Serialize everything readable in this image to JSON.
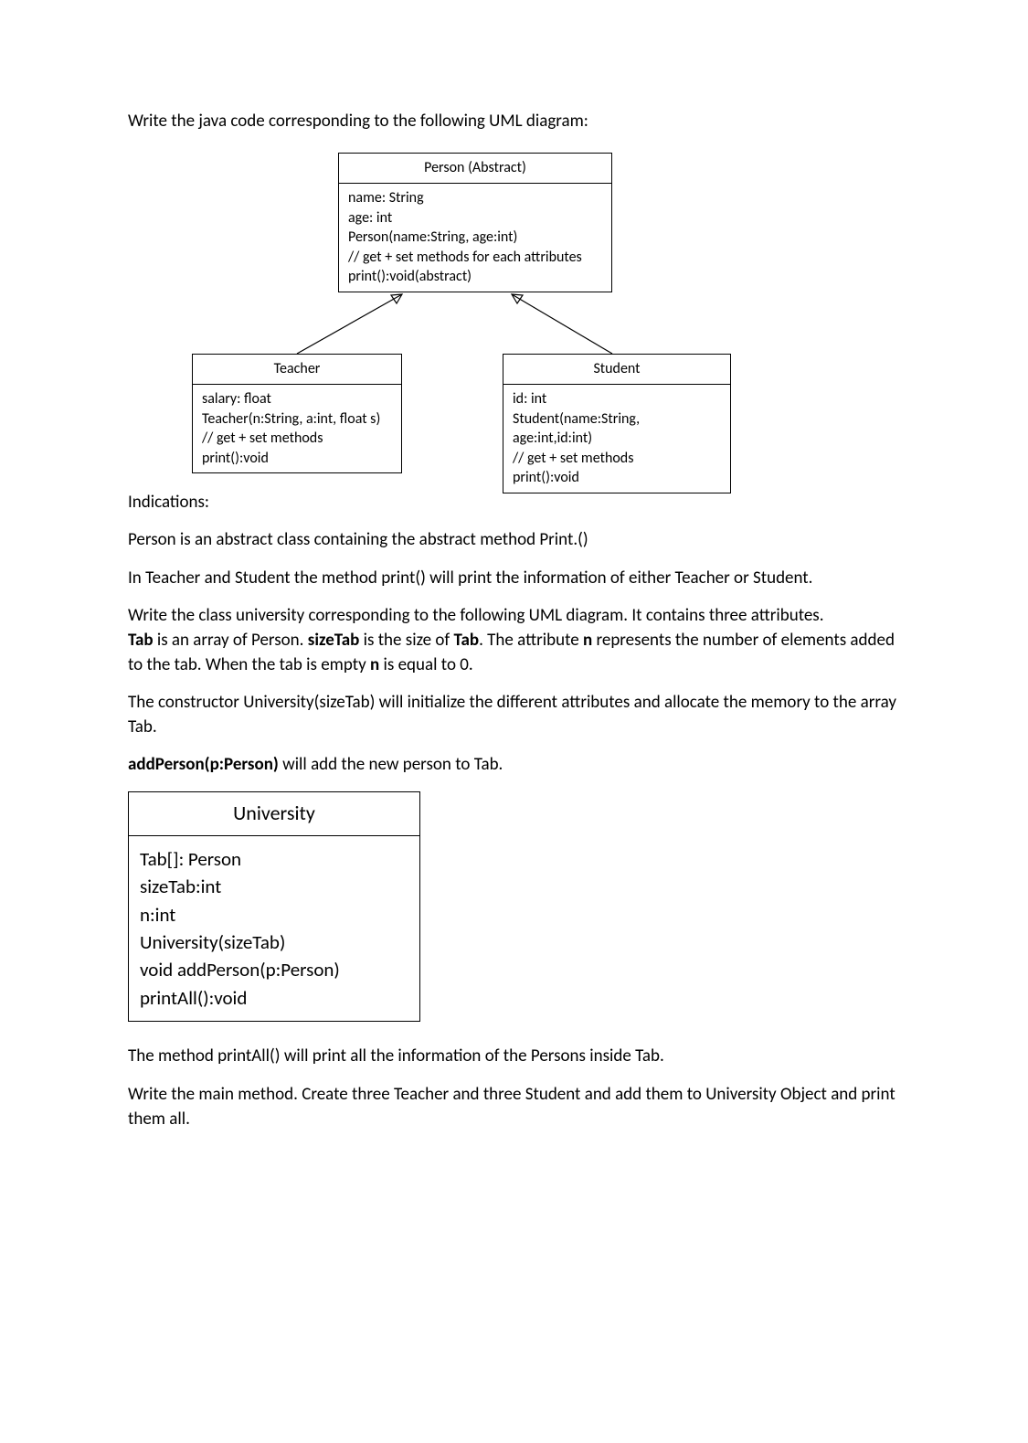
{
  "intro": "Write the java code corresponding to the following UML diagram:",
  "uml": {
    "person": {
      "title": "Person (Abstract)",
      "lines": [
        "name: String",
        "age: int",
        "Person(name:String, age:int)",
        "// get + set methods for each attributes",
        "print():void(abstract)"
      ]
    },
    "teacher": {
      "title": "Teacher",
      "lines": [
        "salary: float",
        "Teacher(n:String, a:int, float s)",
        "// get + set methods",
        "print():void"
      ]
    },
    "student": {
      "title": "Student",
      "lines": [
        "id: int",
        "Student(name:String, age:int,id:int)",
        "// get + set methods",
        "print():void"
      ]
    }
  },
  "indications_heading": "Indications:",
  "para1": "Person is an abstract class containing the abstract method Print.()",
  "para2": "In Teacher and Student the method print() will print the information of either Teacher or Student.",
  "para3_pre": "Write the class university corresponding to the following UML diagram. It contains three attributes.",
  "para3_bold1": "Tab",
  "para3_mid1": " is an array of Person. ",
  "para3_bold2": "sizeTab",
  "para3_mid2": " is the size of ",
  "para3_bold3": "Tab",
  "para3_mid3": ". The attribute ",
  "para3_bold4": "n",
  "para3_mid4": " represents the number of elements added to the tab. When the tab is empty ",
  "para3_bold5": "n",
  "para3_mid5": " is equal to 0.",
  "para4": "The constructor University(sizeTab) will initialize the different attributes and allocate the memory to the array Tab.",
  "para5_bold": "addPerson(p:Person)",
  "para5_rest": " will add the new person to Tab.",
  "university": {
    "title": "University",
    "lines": [
      "Tab[]: Person",
      "sizeTab:int",
      "n:int",
      "University(sizeTab)",
      "void addPerson(p:Person)",
      "printAll():void"
    ]
  },
  "para6": "The method printAll() will print all the information of the Persons inside Tab.",
  "para7": "Write the main method. Create three Teacher and three Student and add them to University Object and print them all."
}
